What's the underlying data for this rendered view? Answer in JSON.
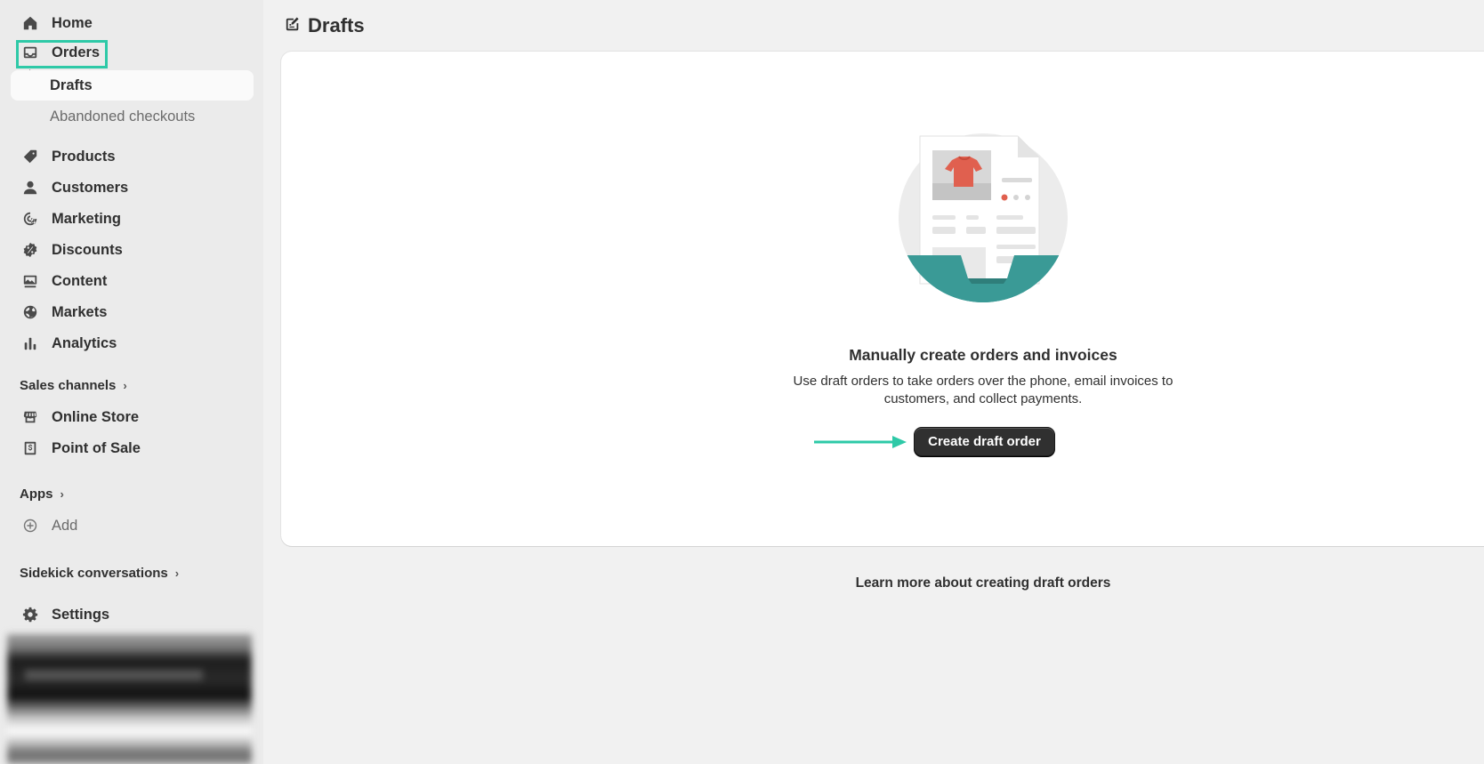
{
  "sidebar": {
    "items": [
      {
        "label": "Home",
        "icon": "home-icon"
      },
      {
        "label": "Orders",
        "icon": "inbox-icon"
      },
      {
        "label": "Drafts"
      },
      {
        "label": "Abandoned checkouts"
      },
      {
        "label": "Products",
        "icon": "tag-icon"
      },
      {
        "label": "Customers",
        "icon": "person-icon"
      },
      {
        "label": "Marketing",
        "icon": "target-icon"
      },
      {
        "label": "Discounts",
        "icon": "discount-icon"
      },
      {
        "label": "Content",
        "icon": "content-icon"
      },
      {
        "label": "Markets",
        "icon": "globe-icon"
      },
      {
        "label": "Analytics",
        "icon": "bar-chart-icon"
      }
    ],
    "sales_channels": {
      "heading": "Sales channels",
      "items": [
        {
          "label": "Online Store",
          "icon": "store-icon"
        },
        {
          "label": "Point of Sale",
          "icon": "pos-icon"
        }
      ]
    },
    "apps": {
      "heading": "Apps",
      "add_label": "Add"
    },
    "sidekick": {
      "heading": "Sidekick conversations"
    },
    "settings": {
      "label": "Settings",
      "icon": "gear-icon"
    }
  },
  "page": {
    "title": "Drafts",
    "empty_state": {
      "heading": "Manually create orders and invoices",
      "description": "Use draft orders to take orders over the phone, email invoices to customers, and collect payments.",
      "button_label": "Create draft order"
    },
    "learn_more": "Learn more about creating draft orders"
  },
  "colors": {
    "highlight": "#2ec9a7",
    "teal": "#3a9a96",
    "button": "#303030"
  }
}
